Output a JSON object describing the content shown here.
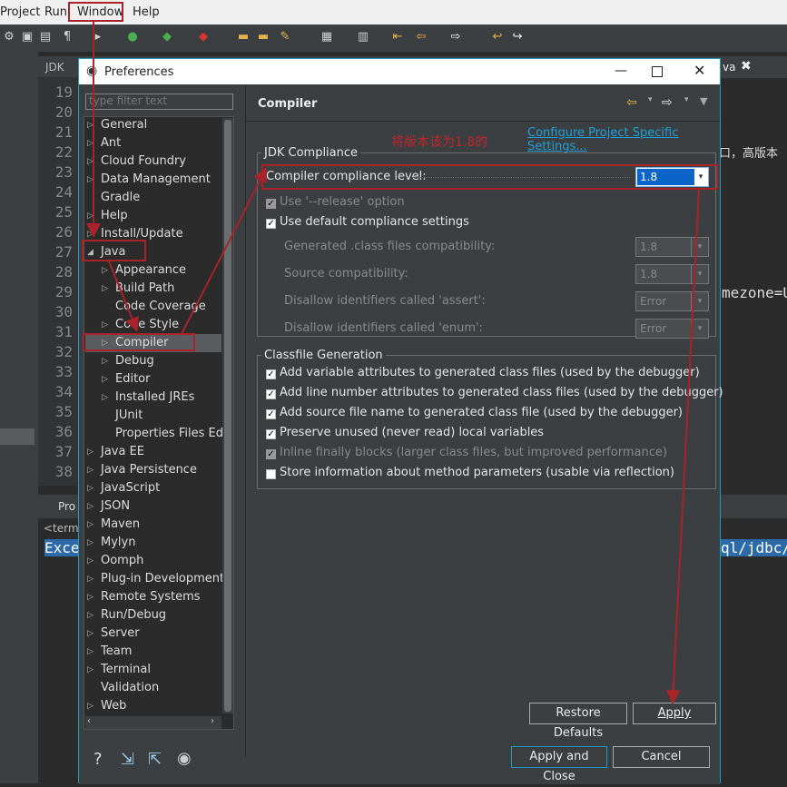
{
  "menubar": {
    "items": [
      "Project",
      "Run",
      "Window",
      "Help"
    ]
  },
  "editor": {
    "tab_label": "JDK",
    "right_tab_label": "va",
    "line_numbers": [
      "19",
      "20",
      "21",
      "22",
      "23",
      "24",
      "25",
      "26",
      "27",
      "28",
      "29",
      "30",
      "31",
      "32",
      "33",
      "34",
      "35",
      "36",
      "37",
      "38"
    ],
    "snippet_1": "口，高版本",
    "snippet_2": "mezone=U"
  },
  "console": {
    "tab_label": "Pro",
    "terminated": "<term",
    "exc_left": "Exce",
    "exc_right": "ql/jdbc/"
  },
  "dialog": {
    "title": "Preferences",
    "filter_placeholder": "type filter text",
    "tree": [
      {
        "label": "General",
        "level": 0,
        "twisty": "closed"
      },
      {
        "label": "Ant",
        "level": 0,
        "twisty": "closed"
      },
      {
        "label": "Cloud Foundry",
        "level": 0,
        "twisty": "closed"
      },
      {
        "label": "Data Management",
        "level": 0,
        "twisty": "closed"
      },
      {
        "label": "Gradle",
        "level": 0,
        "twisty": "none"
      },
      {
        "label": "Help",
        "level": 0,
        "twisty": "closed"
      },
      {
        "label": "Install/Update",
        "level": 0,
        "twisty": "closed"
      },
      {
        "label": "Java",
        "level": 0,
        "twisty": "open"
      },
      {
        "label": "Appearance",
        "level": 1,
        "twisty": "closed"
      },
      {
        "label": "Build Path",
        "level": 1,
        "twisty": "closed"
      },
      {
        "label": "Code Coverage",
        "level": 1,
        "twisty": "none"
      },
      {
        "label": "Code Style",
        "level": 1,
        "twisty": "closed"
      },
      {
        "label": "Compiler",
        "level": 1,
        "twisty": "closed",
        "selected": true
      },
      {
        "label": "Debug",
        "level": 1,
        "twisty": "closed"
      },
      {
        "label": "Editor",
        "level": 1,
        "twisty": "closed"
      },
      {
        "label": "Installed JREs",
        "level": 1,
        "twisty": "closed"
      },
      {
        "label": "JUnit",
        "level": 1,
        "twisty": "none"
      },
      {
        "label": "Properties Files Edi",
        "level": 1,
        "twisty": "none"
      },
      {
        "label": "Java EE",
        "level": 0,
        "twisty": "closed"
      },
      {
        "label": "Java Persistence",
        "level": 0,
        "twisty": "closed"
      },
      {
        "label": "JavaScript",
        "level": 0,
        "twisty": "closed"
      },
      {
        "label": "JSON",
        "level": 0,
        "twisty": "closed"
      },
      {
        "label": "Maven",
        "level": 0,
        "twisty": "closed"
      },
      {
        "label": "Mylyn",
        "level": 0,
        "twisty": "closed"
      },
      {
        "label": "Oomph",
        "level": 0,
        "twisty": "closed"
      },
      {
        "label": "Plug-in Development",
        "level": 0,
        "twisty": "closed"
      },
      {
        "label": "Remote Systems",
        "level": 0,
        "twisty": "closed"
      },
      {
        "label": "Run/Debug",
        "level": 0,
        "twisty": "closed"
      },
      {
        "label": "Server",
        "level": 0,
        "twisty": "closed"
      },
      {
        "label": "Team",
        "level": 0,
        "twisty": "closed"
      },
      {
        "label": "Terminal",
        "level": 0,
        "twisty": "closed"
      },
      {
        "label": "Validation",
        "level": 0,
        "twisty": "none"
      },
      {
        "label": "Web",
        "level": 0,
        "twisty": "closed"
      }
    ],
    "page_title": "Compiler",
    "configure_link": "Configure Project Specific Settings...",
    "annotation": "将版本该为1.8的",
    "jdk_group": {
      "title": "JDK Compliance",
      "compliance_label": "Compiler compliance level:",
      "compliance_value": "1.8",
      "release_option": "Use '--release' option",
      "use_default": "Use default compliance settings",
      "generated_label": "Generated .class files compatibility:",
      "generated_value": "1.8",
      "source_label": "Source compatibility:",
      "source_value": "1.8",
      "assert_label": "Disallow identifiers called 'assert':",
      "assert_value": "Error",
      "enum_label": "Disallow identifiers called 'enum':",
      "enum_value": "Error"
    },
    "classfile_group": {
      "title": "Classfile Generation",
      "options": [
        {
          "label": "Add variable attributes to generated class files (used by the debugger)",
          "checked": true,
          "enabled": true
        },
        {
          "label": "Add line number attributes to generated class files (used by the debugger)",
          "checked": true,
          "enabled": true
        },
        {
          "label": "Add source file name to generated class file (used by the debugger)",
          "checked": true,
          "enabled": true
        },
        {
          "label": "Preserve unused (never read) local variables",
          "checked": true,
          "enabled": true
        },
        {
          "label": "Inline finally blocks (larger class files, but improved performance)",
          "checked": true,
          "enabled": false
        },
        {
          "label": "Store information about method parameters (usable via reflection)",
          "checked": false,
          "enabled": true
        }
      ]
    },
    "buttons": {
      "restore_defaults": "Restore Defaults",
      "apply": "Apply",
      "apply_and_close": "Apply and Close",
      "cancel": "Cancel"
    },
    "colors": {
      "accent": "#1f9bbd",
      "annotation": "#c0262d",
      "selection": "#0a64c9"
    }
  }
}
